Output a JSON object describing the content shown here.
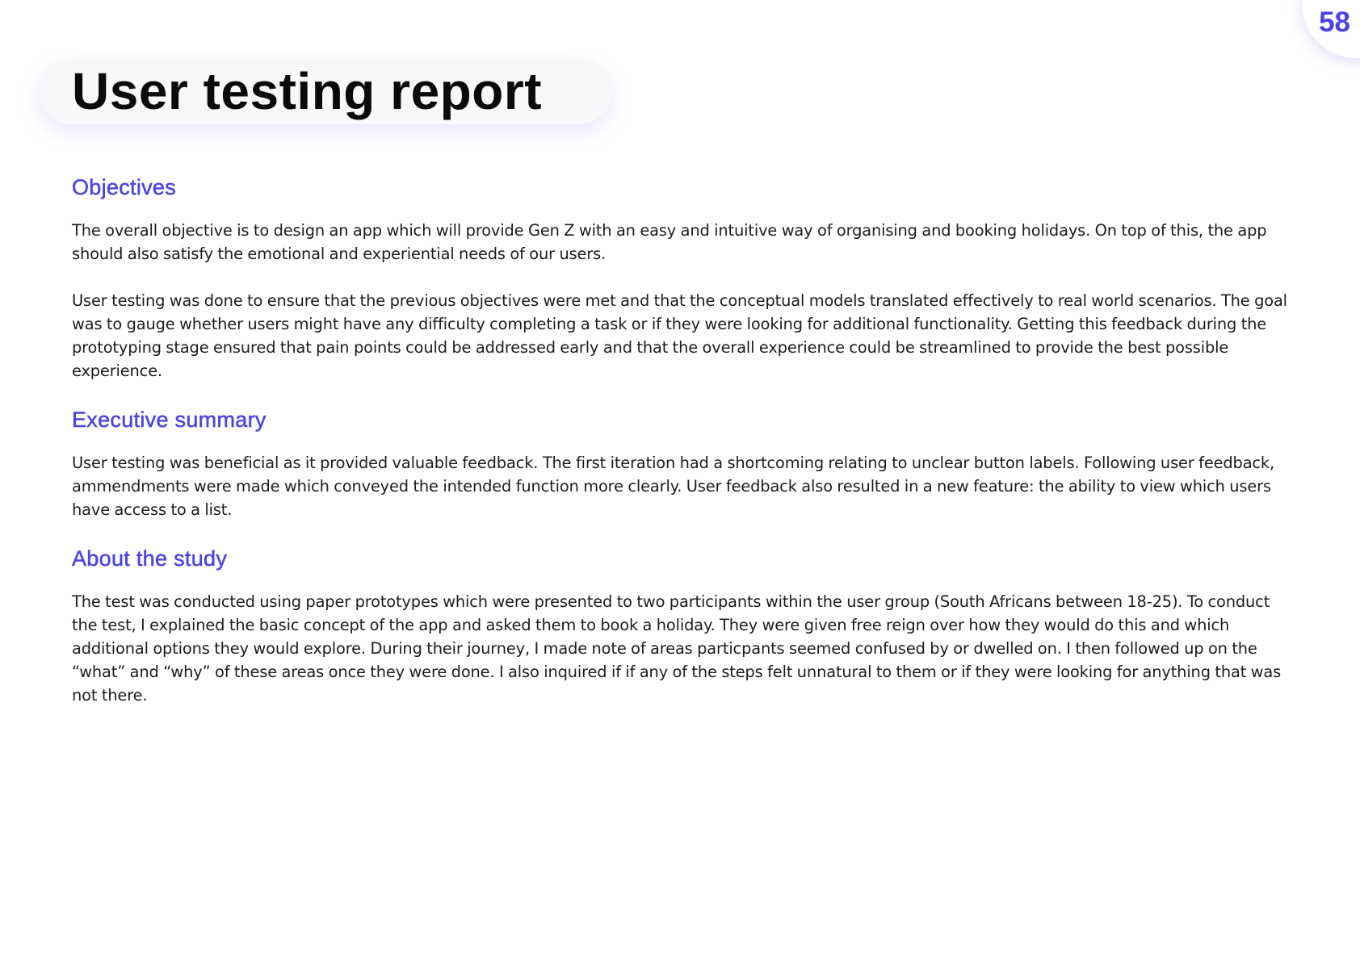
{
  "page": {
    "number": "58",
    "title": "User testing report"
  },
  "sections": [
    {
      "heading": "Objectives",
      "paragraphs": [
        "The overall objective is to design an app which will provide Gen Z with an easy and intuitive way of organising and booking holidays. On top of this, the app should also satisfy the emotional and experiential needs of our users.",
        "User testing was done to ensure that the previous objectives were met and that the conceptual models translated effectively to real world scenarios. The goal was to gauge whether users might have any difficulty completing a task or if they were looking for additional functionality. Getting this feedback during the prototyping stage ensured that pain points could be addressed early and that the overall experience could be streamlined to provide the best possible experience."
      ]
    },
    {
      "heading": "Executive summary",
      "paragraphs": [
        "User testing was beneficial as it provided valuable feedback. The first iteration had a shortcoming relating to unclear button labels. Following user feedback, ammendments were made which conveyed the intended function more clearly. User feedback also resulted in a new feature: the ability to view which users have access to a list."
      ]
    },
    {
      "heading": "About the study",
      "paragraphs": [
        "The test was conducted using paper prototypes which were presented to two participants within the user group (South Africans between 18-25). To conduct the test, I explained the basic concept of the app and asked them to book a holiday. They were given free reign over how they would do this and which additional options they would explore. During their journey, I made note of areas particpants seemed confused by or dwelled on. I then followed up on the “what” and “why” of these areas once they were done. I also inquired if if any of the steps felt unnatural to them or if they were looking for anything that was not there."
      ]
    }
  ],
  "colors": {
    "accent": "#4b43e6",
    "title": "#0a0a0a",
    "body_text": "#1c1c1c",
    "title_pill_bg": "#f8f8fa"
  }
}
